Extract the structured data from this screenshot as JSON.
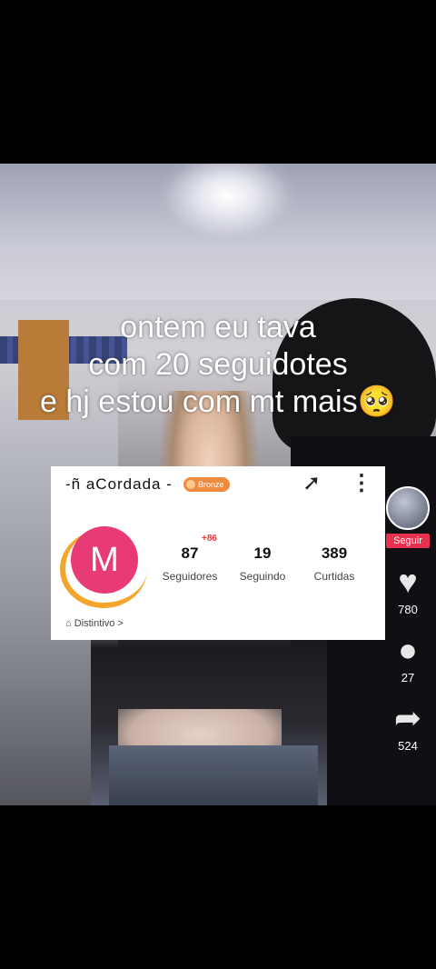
{
  "caption": {
    "line1": "ontem eu tava",
    "line2": "com 20 seguidotes",
    "line3": "e hj estou com mt mais🥺"
  },
  "profile": {
    "name": "-ñ aCordada -",
    "badge": "Bronze",
    "avatar_letter": "M",
    "followers_delta": "+86",
    "stats": [
      {
        "value": "87",
        "label": "Seguidores"
      },
      {
        "value": "19",
        "label": "Seguindo"
      },
      {
        "value": "389",
        "label": "Curtidas"
      }
    ],
    "distintivo": "Distintivo >"
  },
  "side": {
    "follow_label": "Seguir",
    "likes": "780",
    "comments": "27",
    "shares": "524"
  },
  "colors": {
    "avatar": "#e83b75",
    "badge": "#f08a3c",
    "follow": "#e8314e"
  },
  "icons": [
    "share-icon",
    "more-icon",
    "heart-icon",
    "comment-icon",
    "share-arrow-icon",
    "distintivo-icon"
  ]
}
